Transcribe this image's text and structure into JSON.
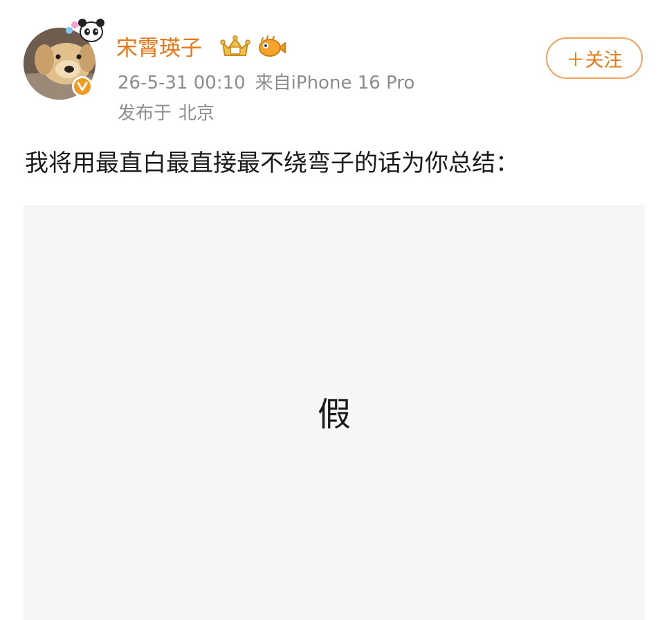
{
  "user": {
    "name": "宋霄瑛子",
    "badges": [
      "crown-badge-icon",
      "pufferfish-badge-icon"
    ],
    "verified": true,
    "avatar_icon": "golden-retriever-avatar"
  },
  "meta": {
    "time": "26-5-31 00:10",
    "source": "来自iPhone 16 Pro",
    "location_prefix": "发布于",
    "location": "北京"
  },
  "follow_button": {
    "label": "＋关注"
  },
  "post": {
    "text": "我将用最直白最直接最不绕弯子的话为你总结：",
    "image_text": "假"
  },
  "colors": {
    "accent": "#e87613",
    "meta": "#8c8c8c",
    "follow_border": "#f0a25b",
    "image_bg": "#f6f6f6",
    "verified": "#f29a1d"
  }
}
